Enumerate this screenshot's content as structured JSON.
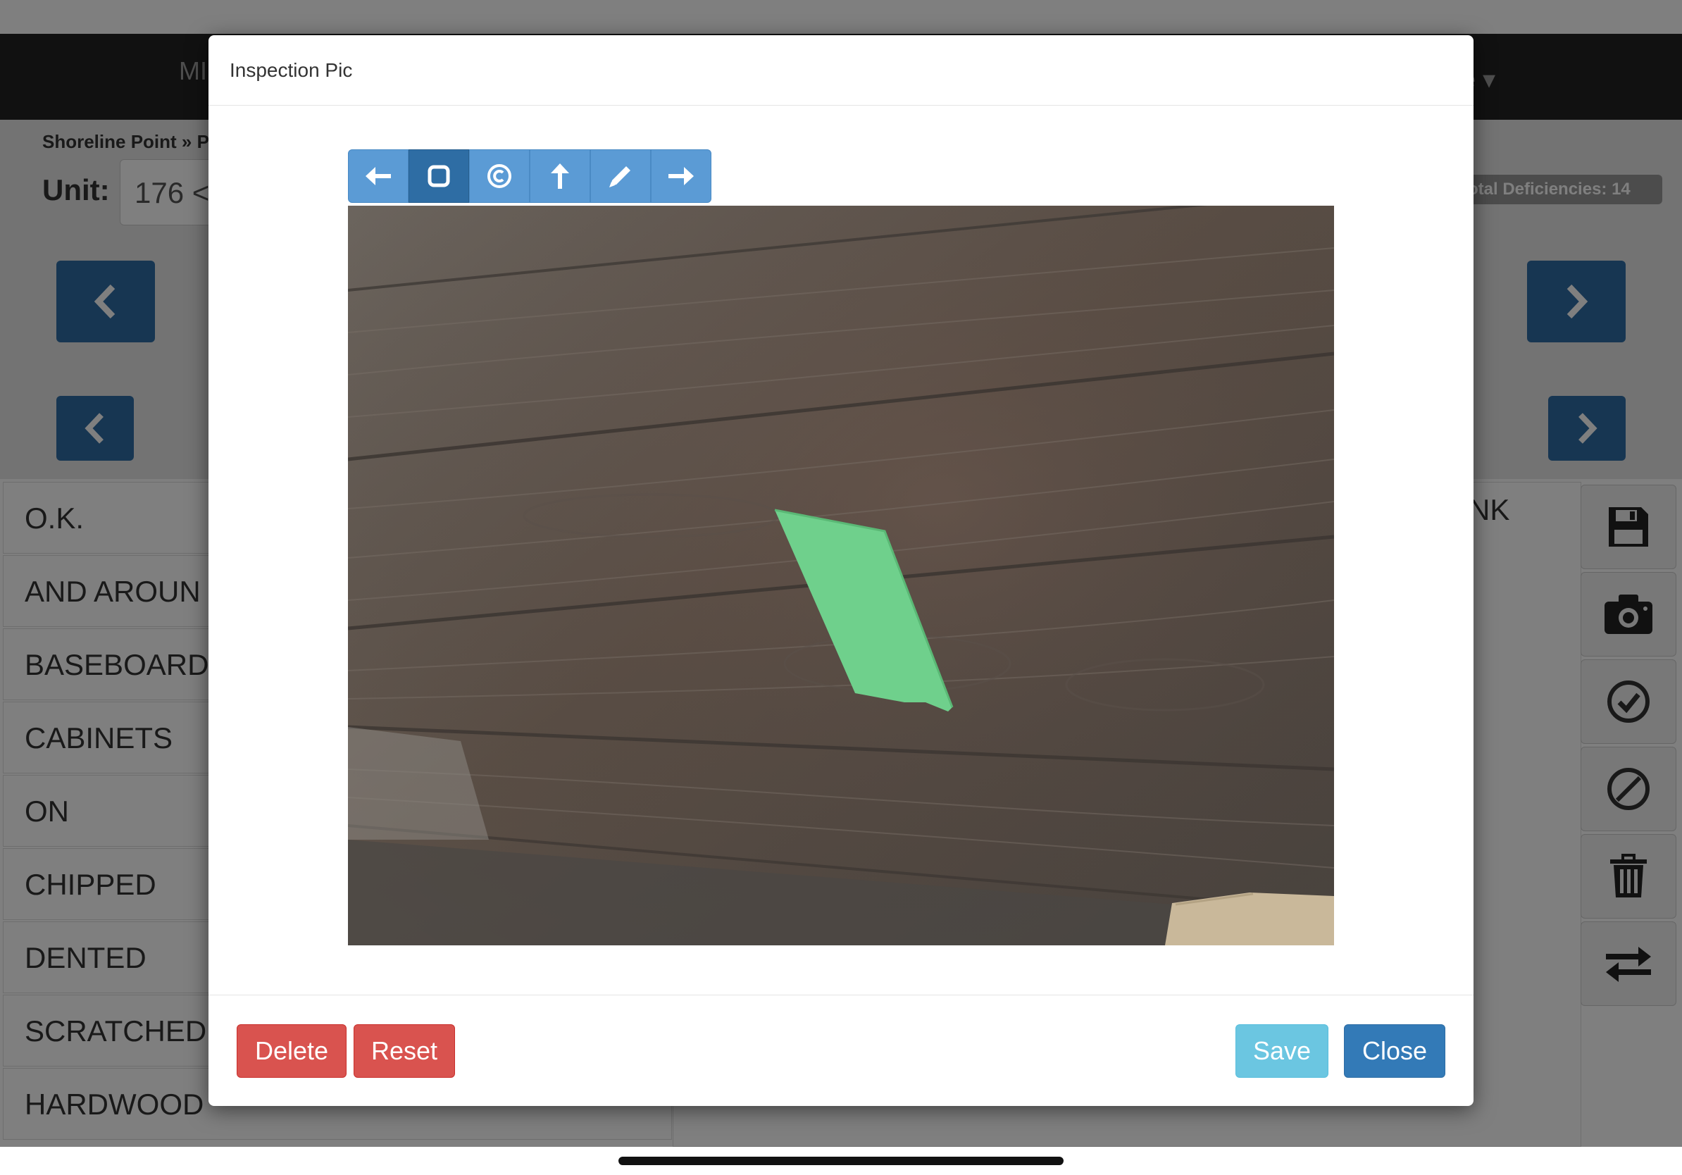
{
  "background": {
    "nav_left_text": "MI",
    "nav_right_text": "e ▾",
    "breadcrumb": "Shoreline Point » Pl",
    "unit_label": "Unit:",
    "unit_value": "176 <",
    "total_deficiencies": "otal Deficiencies: 14",
    "right_text": "NK",
    "list_items": [
      "O.K.",
      "AND AROUN",
      "BASEBOARD",
      "CABINETS",
      "ON",
      "CHIPPED",
      "DENTED",
      "SCRATCHED",
      "HARDWOOD"
    ],
    "side_icons": [
      "save-icon",
      "camera-icon",
      "check-circle-icon",
      "ban-icon",
      "trash-icon",
      "swap-icon"
    ]
  },
  "modal": {
    "title": "Inspection Pic",
    "toolbar_icons": [
      "arrow-left-icon",
      "square-icon",
      "copyright-icon",
      "arrow-up-icon",
      "pencil-icon",
      "arrow-right-icon"
    ],
    "active_tool": "square-icon",
    "buttons": {
      "delete": "Delete",
      "reset": "Reset",
      "save": "Save",
      "close": "Close"
    }
  },
  "colors": {
    "primary": "#337ab7",
    "danger": "#d9534f",
    "info": "#5bc0de",
    "toolbar": "#5b9bd5",
    "toolbar_active": "#2e6da4",
    "tape_green": "#6fd08c"
  }
}
